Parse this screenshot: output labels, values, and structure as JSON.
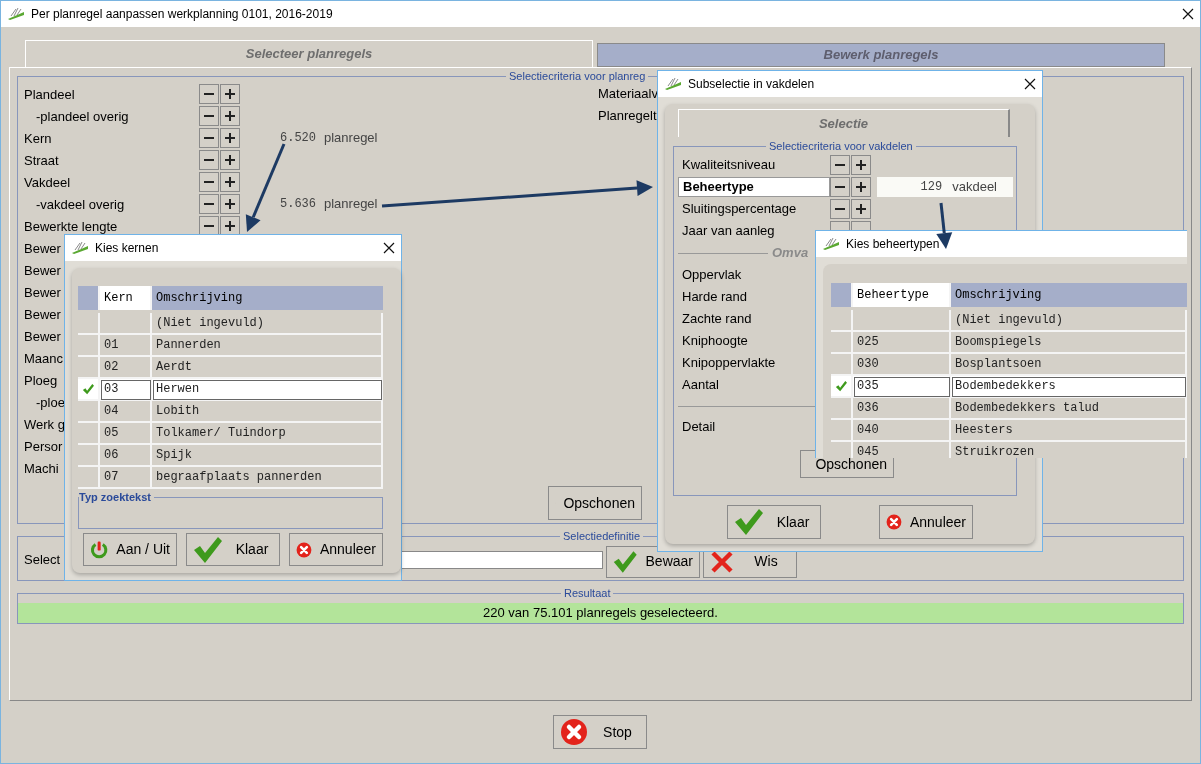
{
  "window": {
    "title": "Per planregel aanpassen werkplanning 0101, 2016-2019"
  },
  "tabs": [
    {
      "label": "Selecteer planregels",
      "selected": true
    },
    {
      "label": "Bewerk planregels",
      "selected": false
    }
  ],
  "criteria": {
    "legend": "Selectiecriteria voor planreg",
    "rows": [
      {
        "label": "Plandeel",
        "kind": "main",
        "controls": true
      },
      {
        "label": "-plandeel overig",
        "kind": "sub",
        "controls": true
      },
      {
        "label": "Kern",
        "kind": "main",
        "controls": true,
        "count": "6.520",
        "unit": "planregel"
      },
      {
        "label": "Straat",
        "kind": "main",
        "controls": true
      },
      {
        "label": "Vakdeel",
        "kind": "main",
        "controls": true
      },
      {
        "label": "-vakdeel overig",
        "kind": "sub",
        "controls": true,
        "count": "5.636",
        "unit": "planregel"
      },
      {
        "label": "Bewerkte lengte",
        "kind": "main",
        "controls": true
      },
      {
        "label": "Bewer",
        "kind": "main",
        "controls": false
      },
      {
        "label": "Bewer",
        "kind": "main",
        "controls": false
      },
      {
        "label": "Bewer",
        "kind": "main",
        "controls": false
      },
      {
        "label": "Bewer",
        "kind": "main",
        "controls": false
      },
      {
        "label": "Bewer",
        "kind": "main",
        "controls": false
      },
      {
        "label": "Maanc",
        "kind": "main",
        "controls": false
      },
      {
        "label": "Ploeg",
        "kind": "main",
        "controls": false
      },
      {
        "label": "-ploe",
        "kind": "sub",
        "controls": false
      },
      {
        "label": "Werk g",
        "kind": "main",
        "controls": false
      },
      {
        "label": "Persor",
        "kind": "main",
        "controls": false
      },
      {
        "label": "Machi",
        "kind": "main",
        "controls": false
      }
    ],
    "right_labels": [
      "Materiaalv",
      "Planregelt"
    ],
    "cleanup_button": {
      "kind": "cleanup",
      "label": "Opschonen"
    }
  },
  "definition": {
    "legend": "Selectiedefinitie",
    "label": "Select",
    "buttons": [
      {
        "kind": "save",
        "label": "Bewaar"
      },
      {
        "kind": "delete",
        "label": "Wis"
      }
    ]
  },
  "result": {
    "legend": "Resultaat",
    "text": "220 van 75.101 planregels geselecteerd."
  },
  "stop_button": {
    "kind": "cancel",
    "label": "Stop"
  },
  "kernen_dialog": {
    "title": "Kies kernen",
    "columns": [
      "Kern",
      "Omschrijving"
    ],
    "rows": [
      {
        "code": "",
        "name": "(Niet ingevuld)",
        "checked": false
      },
      {
        "code": "01",
        "name": "Pannerden",
        "checked": false
      },
      {
        "code": "02",
        "name": "Aerdt",
        "checked": false
      },
      {
        "code": "03",
        "name": "Herwen",
        "checked": true
      },
      {
        "code": "04",
        "name": "Lobith",
        "checked": false
      },
      {
        "code": "05",
        "name": "Tolkamer/ Tuindorp",
        "checked": false
      },
      {
        "code": "06",
        "name": "Spijk",
        "checked": false
      },
      {
        "code": "07",
        "name": "begraafplaats pannerden",
        "checked": false
      }
    ],
    "search_legend": "Typ zoektekst",
    "buttons": [
      {
        "kind": "power",
        "label": "Aan / Uit"
      },
      {
        "kind": "done",
        "label": "Klaar"
      },
      {
        "kind": "cancel",
        "label": "Annuleer"
      }
    ]
  },
  "subselectie_dialog": {
    "title": "Subselectie in vakdelen",
    "tab": {
      "label": "Selectie",
      "selected": true
    },
    "legend": "Selectiecriteria voor vakdelen",
    "rows": [
      {
        "label": "Kwaliteitsniveau",
        "controls": true,
        "selected": false
      },
      {
        "label": "Beheertype",
        "controls": true,
        "selected": true,
        "count": "129",
        "unit": "vakdeel"
      },
      {
        "label": "Sluitingspercentage",
        "controls": true,
        "selected": false
      },
      {
        "label": "Jaar van aanleg",
        "controls": true,
        "selected": false
      }
    ],
    "size_legend": "Omva",
    "size_rows": [
      "Oppervlak",
      "Harde rand",
      "Zachte rand",
      "Kniphoogte",
      "Knipoppervlakte",
      "Aantal"
    ],
    "detail_label": "Detail",
    "cleanup_button": {
      "kind": "cleanup",
      "label": "Opschonen"
    },
    "buttons": [
      {
        "kind": "done",
        "label": "Klaar"
      },
      {
        "kind": "cancel",
        "label": "Annuleer"
      }
    ]
  },
  "beheer_dialog": {
    "title": "Kies beheertypen",
    "columns": [
      "Beheertype",
      "Omschrijving"
    ],
    "rows": [
      {
        "code": "",
        "name": "(Niet ingevuld)",
        "checked": false
      },
      {
        "code": "025",
        "name": "Boomspiegels",
        "checked": false
      },
      {
        "code": "030",
        "name": "Bosplantsoen",
        "checked": false
      },
      {
        "code": "035",
        "name": "Bodembedekkers",
        "checked": true
      },
      {
        "code": "036",
        "name": "Bodembedekkers talud",
        "checked": false
      },
      {
        "code": "040",
        "name": "Heesters",
        "checked": false
      },
      {
        "code": "045",
        "name": "Struikrozen",
        "checked": false
      }
    ]
  }
}
